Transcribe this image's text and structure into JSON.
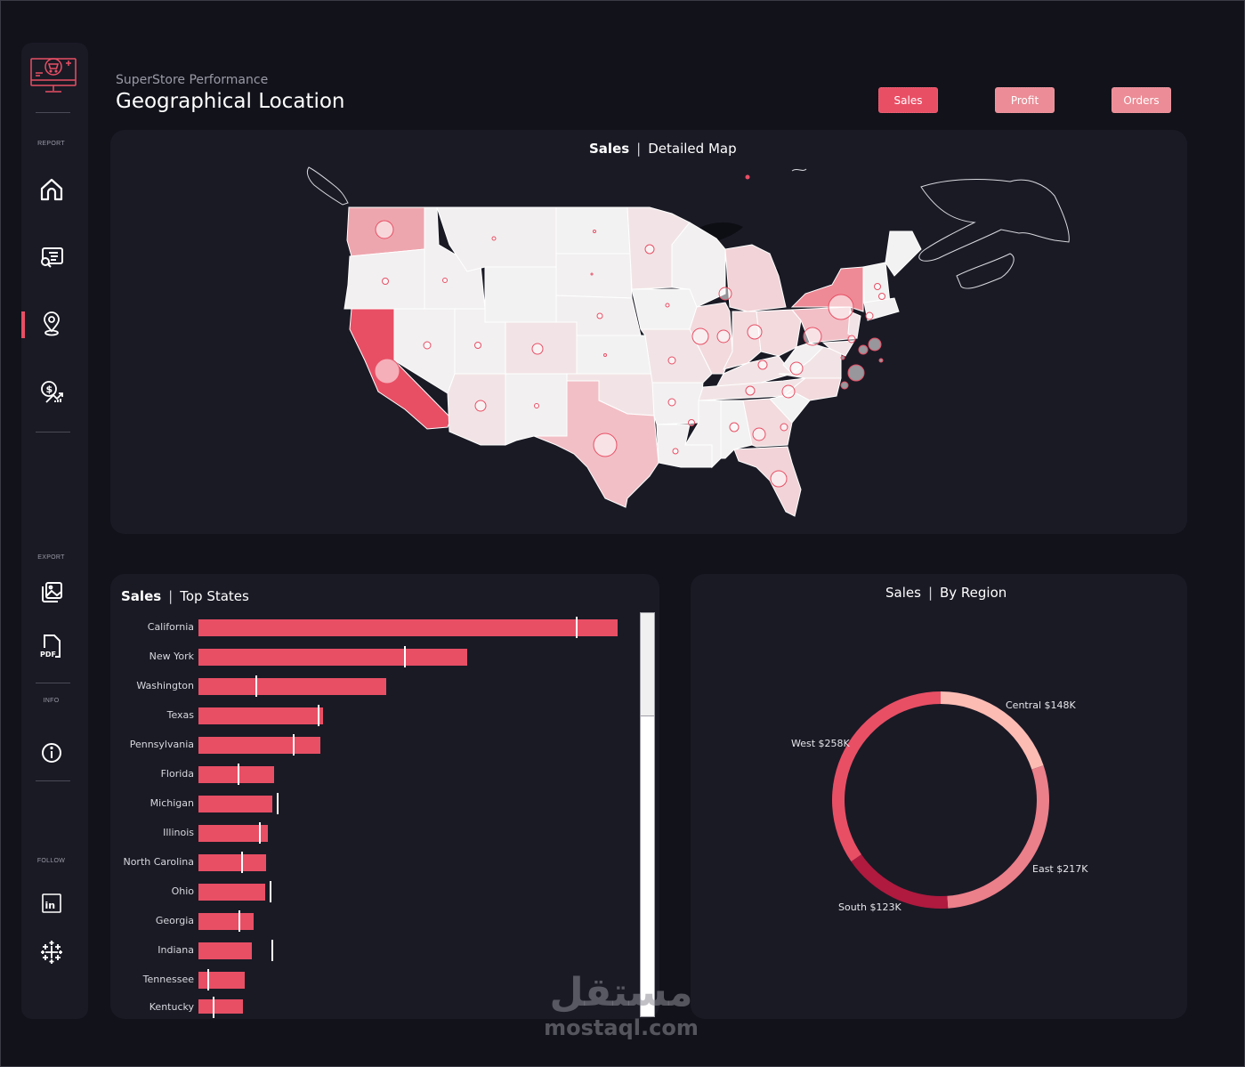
{
  "header": {
    "subtitle": "SuperStore Performance",
    "title": "Geographical Location"
  },
  "toggles": [
    {
      "label": "Sales",
      "active": true
    },
    {
      "label": "Profit",
      "active": false
    },
    {
      "label": "Orders",
      "active": false
    }
  ],
  "sidebar": {
    "logo": "superstore-monitor-cart-logo",
    "sections": {
      "report": "REPORT",
      "export": "EXPORT",
      "info": "INFO",
      "follow": "FOLLOW"
    },
    "report_items": [
      {
        "icon": "home-icon",
        "active": false
      },
      {
        "icon": "report-search-icon",
        "active": false
      },
      {
        "icon": "location-pin-icon",
        "active": true
      },
      {
        "icon": "dollar-growth-icon",
        "active": false
      }
    ],
    "export_items": [
      {
        "icon": "image-export-icon"
      },
      {
        "icon": "pdf-export-icon",
        "text": "PDF"
      }
    ],
    "info_items": [
      {
        "icon": "info-icon"
      }
    ],
    "follow_items": [
      {
        "icon": "linkedin-icon",
        "text": "in"
      },
      {
        "icon": "tableau-icon"
      }
    ]
  },
  "map_panel": {
    "title_bold": "Sales",
    "separator": "|",
    "title_rest": "Detailed Map",
    "highlight_states": [
      "California",
      "New York",
      "Washington",
      "Texas",
      "Pennsylvania"
    ],
    "colors": {
      "high": "#e84f65",
      "mid": "#ee8a95",
      "low": "#f3c3c9",
      "base": "#f2f0f1"
    }
  },
  "top_states_panel": {
    "title_bold": "Sales",
    "separator": "|",
    "title_rest": "Top States",
    "chart_data": {
      "type": "bar",
      "orientation": "horizontal",
      "title": "Sales | Top States",
      "unit": "$K (estimated)",
      "categories": [
        "California",
        "New York",
        "Washington",
        "Texas",
        "Pennsylvania",
        "Florida",
        "Michigan",
        "Illinois",
        "North Carolina",
        "Ohio",
        "Georgia",
        "Indiana",
        "Tennessee",
        "Kentucky"
      ],
      "series": [
        {
          "name": "Sales",
          "values": [
            457.7,
            293.5,
            205.1,
            136.1,
            133.2,
            82.6,
            80.7,
            75.8,
            73.9,
            72.9,
            60.3,
            58.3,
            50.5,
            48.6
          ]
        },
        {
          "name": "Reference marker",
          "values": [
            413.0,
            225.5,
            63.2,
            131.2,
            104.0,
            43.7,
            86.5,
            67.1,
            47.6,
            78.7,
            44.7,
            80.7,
            10.7,
            16.5
          ]
        }
      ],
      "xlim": [
        0,
        457.7
      ],
      "scrollbar_visible_fraction": 0.26
    }
  },
  "region_panel": {
    "title_bold": "Sales",
    "separator": "|",
    "title_rest": "By Region",
    "chart_data": {
      "type": "pie",
      "variant": "donut",
      "title": "Sales | By Region",
      "slices": [
        {
          "label": "Central",
          "value": 148,
          "display": "Central $148K",
          "color": "#fcbcb4"
        },
        {
          "label": "East",
          "value": 217,
          "display": "East $217K",
          "color": "#eb7f8a"
        },
        {
          "label": "South",
          "value": 123,
          "display": "South $123K",
          "color": "#af1a3e"
        },
        {
          "label": "West",
          "value": 258,
          "display": "West $258K",
          "color": "#e84f65"
        }
      ]
    }
  },
  "watermark": {
    "arabic": "مستقل",
    "latin": "mostaql.com"
  }
}
